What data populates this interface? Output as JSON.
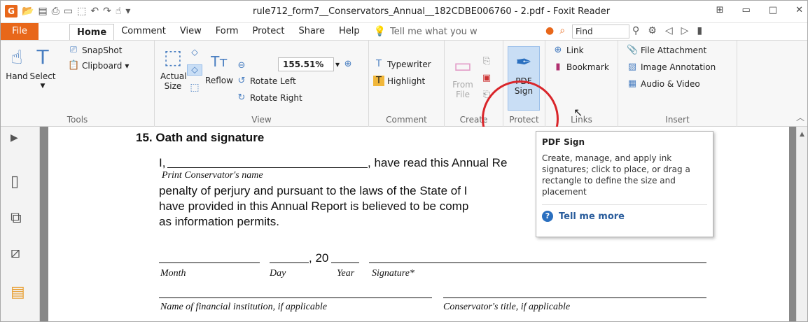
{
  "window": {
    "title": "rule712_form7__Conservators_Annual__182CDBE006760 - 2.pdf - Foxit Reader"
  },
  "tabs": {
    "file": "File",
    "items": [
      "Home",
      "Comment",
      "View",
      "Form",
      "Protect",
      "Share",
      "Help"
    ],
    "tellme": "Tell me what you w",
    "find": "Find"
  },
  "ribbon": {
    "tools": {
      "hand": "Hand",
      "select": "Select",
      "snapshot": "SnapShot",
      "clipboard": "Clipboard",
      "label": "Tools"
    },
    "view": {
      "actual_size": "Actual Size",
      "reflow": "Reflow",
      "zoom": "155.51%",
      "rotate_left": "Rotate Left",
      "rotate_right": "Rotate Right",
      "label": "View"
    },
    "comment": {
      "typewriter": "Typewriter",
      "highlight": "Highlight",
      "label": "Comment"
    },
    "create": {
      "from_file": "From File",
      "label": "Create"
    },
    "protect": {
      "pdf_sign": "PDF Sign",
      "label": "Protect"
    },
    "links": {
      "link": "Link",
      "bookmark": "Bookmark",
      "label": "Links"
    },
    "insert": {
      "file_attachment": "File Attachment",
      "image_annotation": "Image Annotation",
      "audio_video": "Audio & Video",
      "label": "Insert"
    }
  },
  "document": {
    "heading": "15. Oath and signature",
    "line1_start": "I,",
    "line1_end": ", have read this Annual Re",
    "print_label": "Print Conservator's name",
    "line2": "penalty of perjury and pursuant to the laws of the State of I",
    "line3": "have provided in this Annual Report is believed to be comp",
    "line4": "as information permits.",
    "year_prefix": ", 20",
    "month": "Month",
    "day": "Day",
    "year": "Year",
    "signature": "Signature*",
    "institution": "Name of financial institution, if applicable",
    "conservator_title": "Conservator's title, if applicable"
  },
  "tooltip": {
    "title": "PDF Sign",
    "body": "Create, manage, and apply ink signatures; click to place, or drag a rectangle to define the size and placement",
    "more": "Tell me more"
  },
  "colors": {
    "accent": "#e8671a",
    "highlight_circle": "#d9252a",
    "link": "#2a5d9c"
  }
}
